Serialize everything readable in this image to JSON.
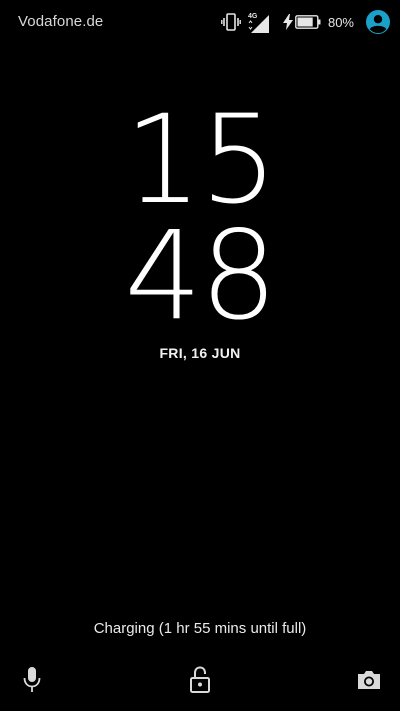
{
  "status_bar": {
    "carrier": "Vodafone.de",
    "network_type": "4G",
    "battery_percent": "80%",
    "battery_level": 0.8,
    "icons": [
      "vibrate-icon",
      "signal-icon",
      "charging-bolt-icon",
      "battery-icon",
      "account-avatar-icon"
    ],
    "accent_color": "#1aa1c8"
  },
  "lockscreen": {
    "hours": "15",
    "minutes": "48",
    "date": "FRI, 16 JUN",
    "charging_status": "Charging (1 hr 55 mins until full)"
  },
  "bottom_actions": {
    "left": "microphone-icon",
    "center": "unlock-icon",
    "right": "camera-icon"
  }
}
